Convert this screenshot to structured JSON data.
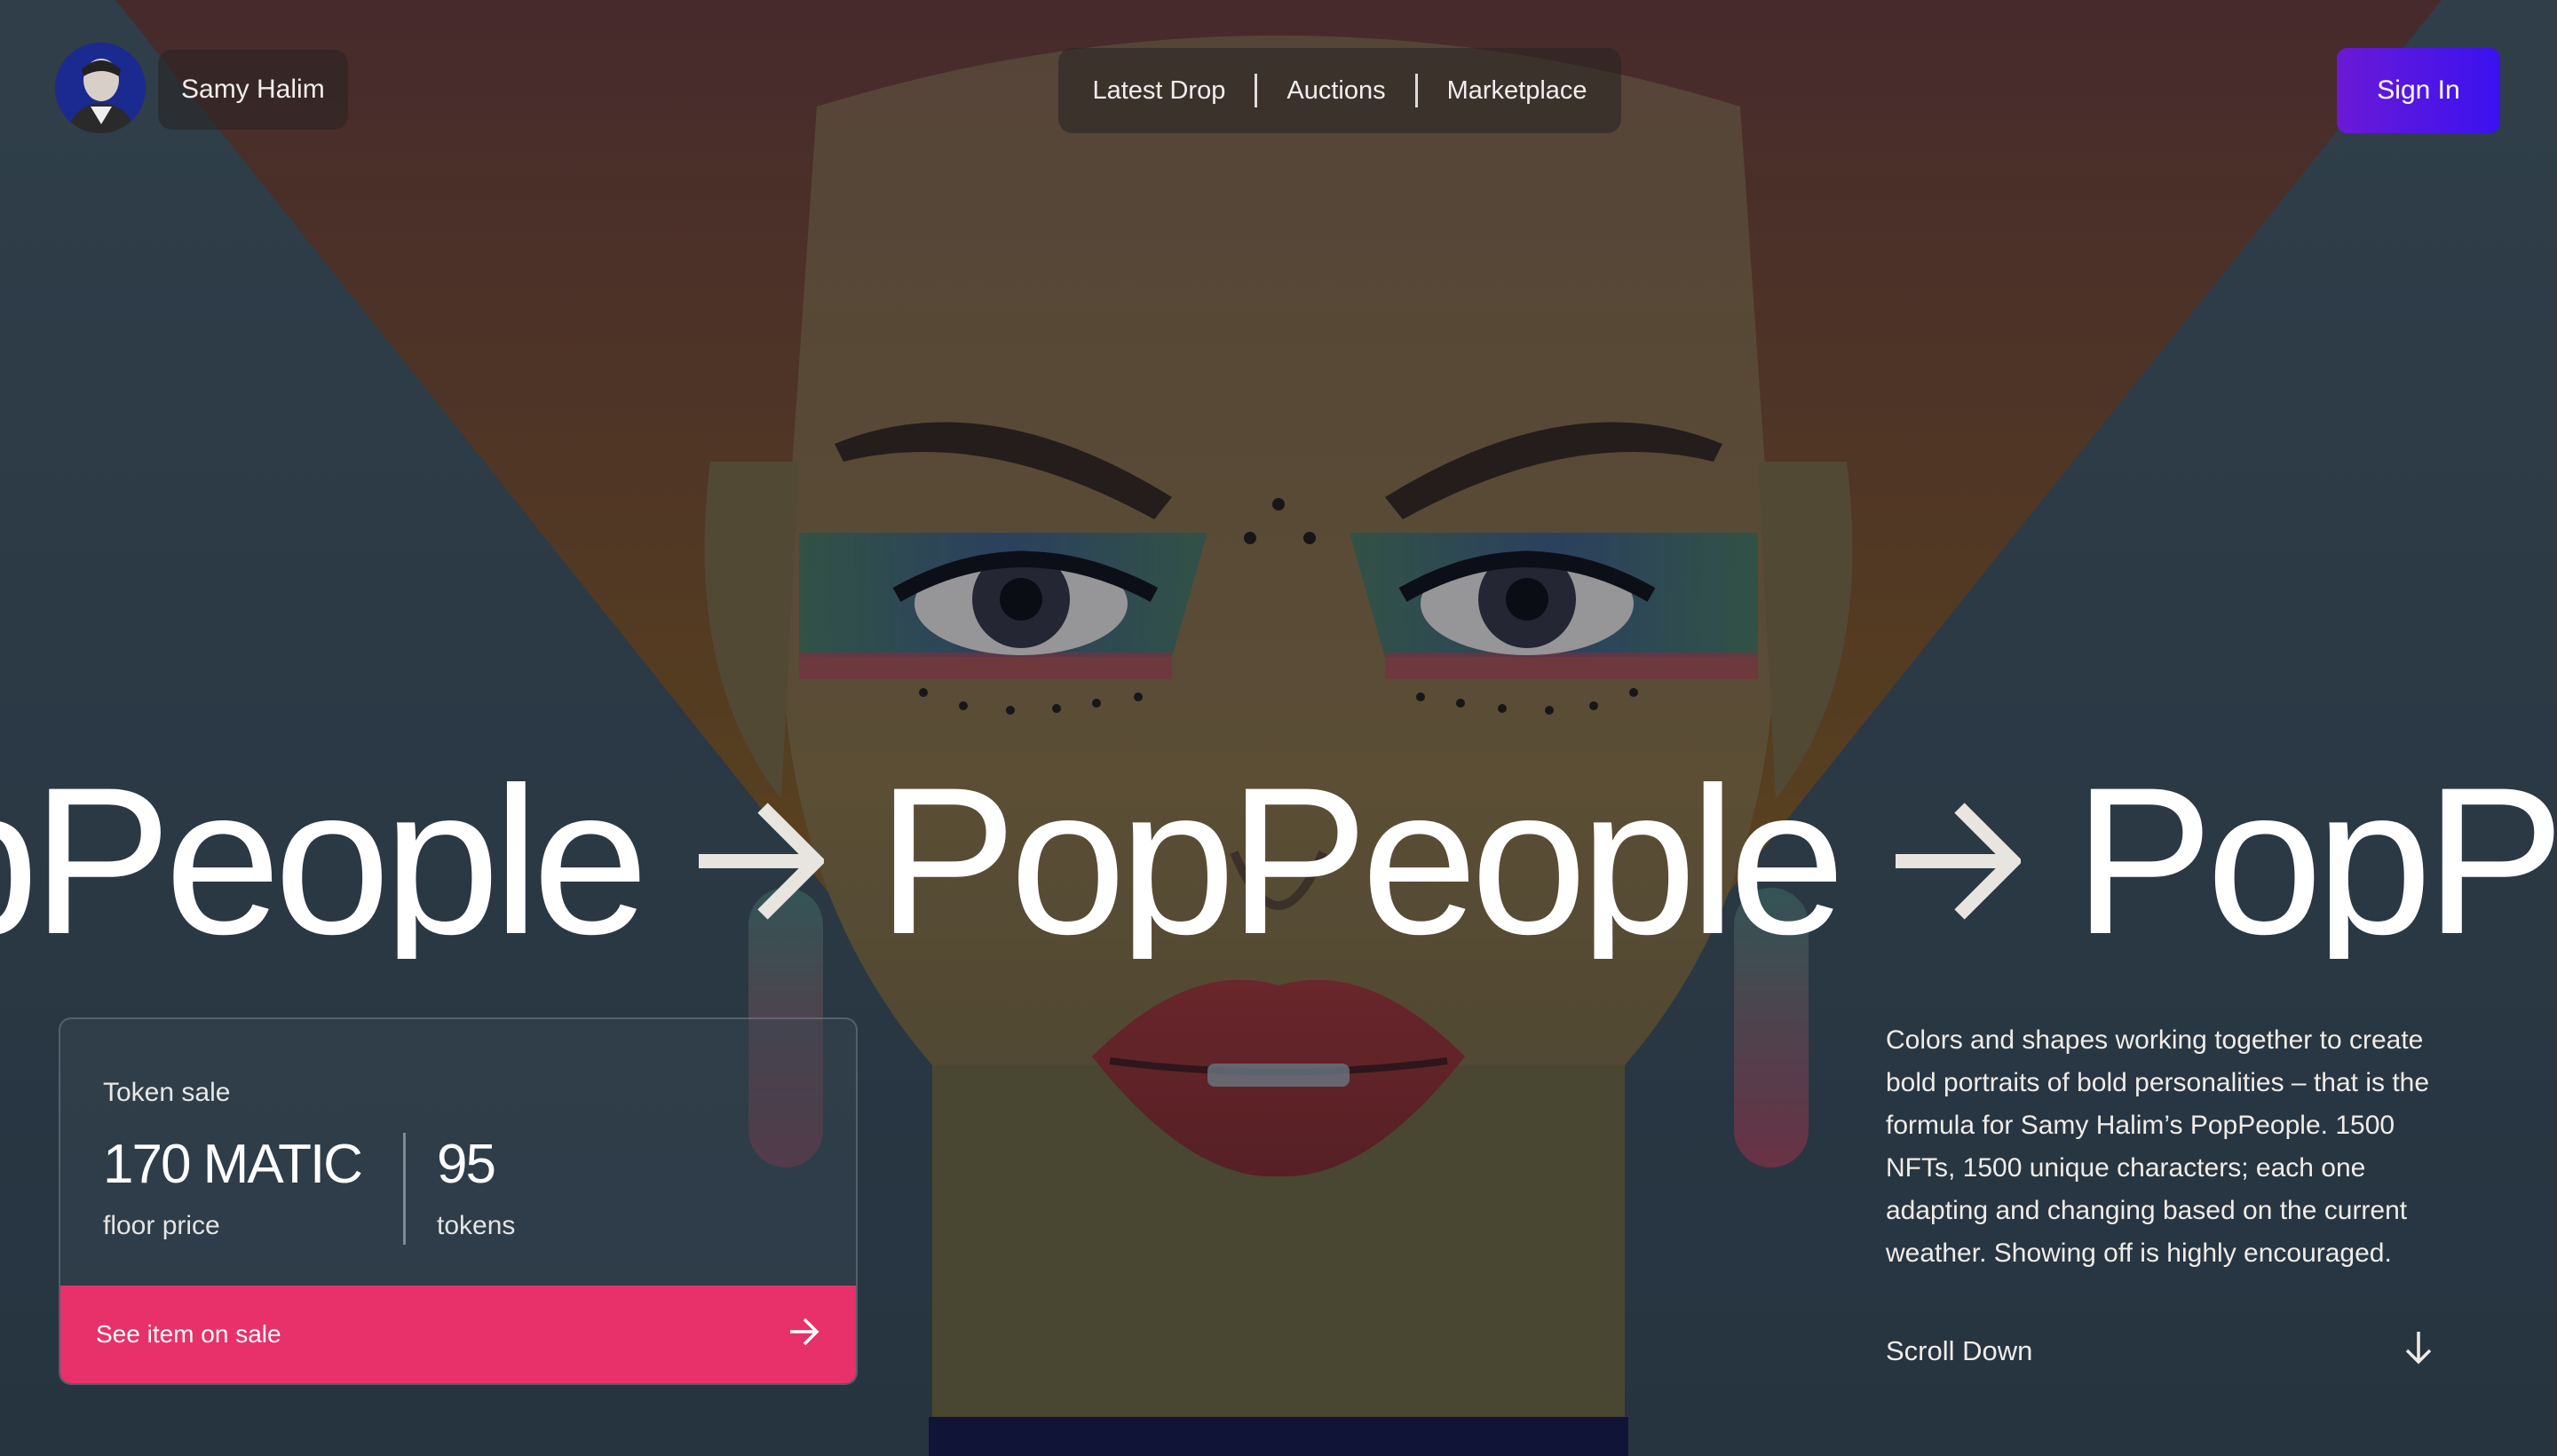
{
  "header": {
    "artist_name": "Samy Halim",
    "nav": [
      {
        "label": "Latest Drop"
      },
      {
        "label": "Auctions"
      },
      {
        "label": "Marketplace"
      }
    ],
    "sign_in_label": "Sign In"
  },
  "hero": {
    "title_words": [
      "PopPeople",
      "PopPeople",
      "PopPeople"
    ],
    "icons": {
      "marquee_separator": "arrow-right-icon"
    }
  },
  "token_sale": {
    "label": "Token sale",
    "floor_price": "170 MATIC",
    "floor_price_label": "floor price",
    "tokens": "95",
    "tokens_label": "tokens",
    "cta_label": "See item on sale",
    "cta_icon": "arrow-right-icon",
    "cta_color": "#e8306a"
  },
  "description": {
    "text": "Colors and shapes working together to create bold portraits of bold personalities – that is the formula for Samy Halim’s PopPeople. 1500 NFTs, 1500 unique characters; each one adapting and changing based on the current weather. Showing off is highly encouraged.",
    "scroll_label": "Scroll Down",
    "scroll_icon": "arrow-down-icon"
  },
  "colors": {
    "sign_in_gradient_start": "#6b1ad6",
    "sign_in_gradient_end": "#3a12f0",
    "background": "#3b4f5e"
  }
}
